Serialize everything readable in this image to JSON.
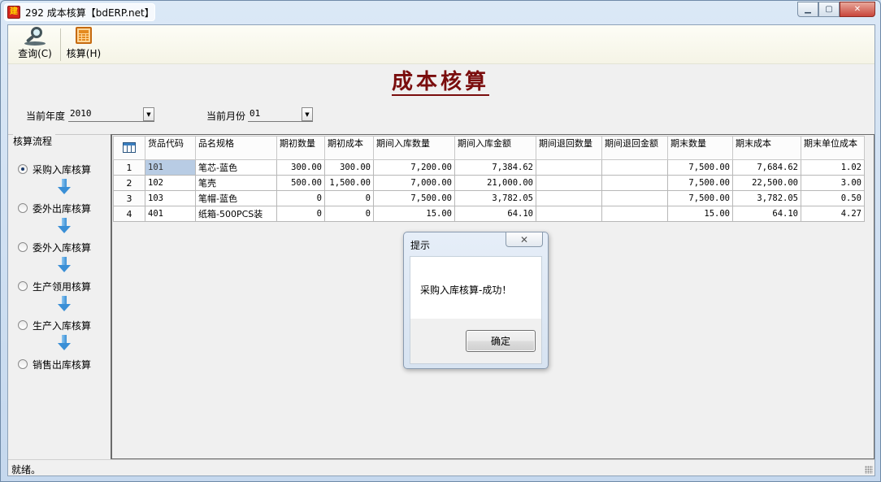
{
  "window": {
    "title": "292 成本核算【bdERP.net】",
    "icon_label": "建",
    "controls": [
      "minimize-icon",
      "maximize-icon",
      "close-icon"
    ]
  },
  "toolbar": {
    "query_label": "查询(C)",
    "calc_label": "核算(H)"
  },
  "page": {
    "title": "成本核算"
  },
  "filters": {
    "year_label": "当前年度",
    "year_value": "2010",
    "month_label": "当前月份",
    "month_value": "01"
  },
  "flow": {
    "title": "核算流程",
    "items": [
      {
        "label": "采购入库核算",
        "checked": true
      },
      {
        "label": "委外出库核算",
        "checked": false
      },
      {
        "label": "委外入库核算",
        "checked": false
      },
      {
        "label": "生产领用核算",
        "checked": false
      },
      {
        "label": "生产入库核算",
        "checked": false
      },
      {
        "label": "销售出库核算",
        "checked": false
      }
    ]
  },
  "grid": {
    "columns": [
      "货品代码",
      "品名规格",
      "期初数量",
      "期初成本",
      "期间入库数量",
      "期间入库金额",
      "期间退回数量",
      "期间退回金额",
      "期末数量",
      "期末成本",
      "期末单位成本"
    ],
    "rows": [
      {
        "no": "1",
        "code": "101",
        "name": "笔芯-蓝色",
        "open_qty": "300.00",
        "open_cost": "300.00",
        "in_qty": "7,200.00",
        "in_amt": "7,384.62",
        "ret_qty": "",
        "ret_amt": "",
        "end_qty": "7,500.00",
        "end_cost": "7,684.62",
        "unit_cost": "1.02"
      },
      {
        "no": "2",
        "code": "102",
        "name": "笔壳",
        "open_qty": "500.00",
        "open_cost": "1,500.00",
        "in_qty": "7,000.00",
        "in_amt": "21,000.00",
        "ret_qty": "",
        "ret_amt": "",
        "end_qty": "7,500.00",
        "end_cost": "22,500.00",
        "unit_cost": "3.00"
      },
      {
        "no": "3",
        "code": "103",
        "name": "笔帽-蓝色",
        "open_qty": "0",
        "open_cost": "0",
        "in_qty": "7,500.00",
        "in_amt": "3,782.05",
        "ret_qty": "",
        "ret_amt": "",
        "end_qty": "7,500.00",
        "end_cost": "3,782.05",
        "unit_cost": "0.50"
      },
      {
        "no": "4",
        "code": "401",
        "name": "纸箱-500PCS装",
        "open_qty": "0",
        "open_cost": "0",
        "in_qty": "15.00",
        "in_amt": "64.10",
        "ret_qty": "",
        "ret_amt": "",
        "end_qty": "15.00",
        "end_cost": "64.10",
        "unit_cost": "4.27"
      }
    ]
  },
  "dialog": {
    "title": "提示",
    "message": "采购入库核算-成功！",
    "ok_label": "确定"
  },
  "status": {
    "text": "就绪。"
  }
}
